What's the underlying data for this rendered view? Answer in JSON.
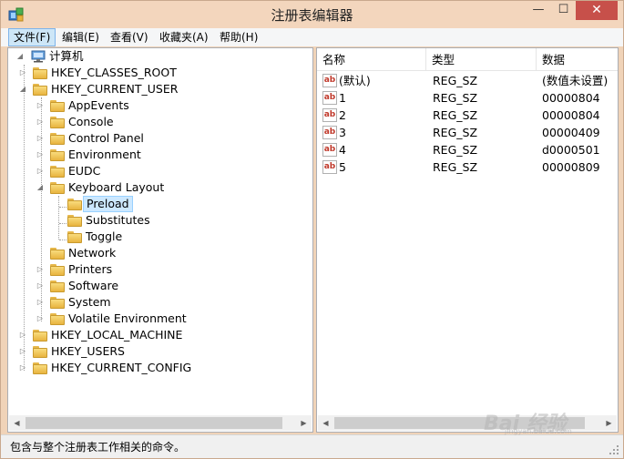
{
  "window": {
    "title": "注册表编辑器"
  },
  "titlebar": {
    "minimize": "—",
    "maximize": "☐",
    "close": "✕"
  },
  "menu": [
    {
      "label": "文件(F)"
    },
    {
      "label": "编辑(E)"
    },
    {
      "label": "查看(V)"
    },
    {
      "label": "收藏夹(A)"
    },
    {
      "label": "帮助(H)"
    }
  ],
  "tree": {
    "root": "计算机",
    "nodes": [
      {
        "label": "HKEY_CLASSES_ROOT",
        "expander": "▷"
      },
      {
        "label": "HKEY_CURRENT_USER",
        "expander": "◢"
      },
      {
        "label": "AppEvents",
        "expander": "▷"
      },
      {
        "label": "Console",
        "expander": "▷"
      },
      {
        "label": "Control Panel",
        "expander": "▷"
      },
      {
        "label": "Environment",
        "expander": "▷"
      },
      {
        "label": "EUDC",
        "expander": "▷"
      },
      {
        "label": "Keyboard Layout",
        "expander": "◢"
      },
      {
        "label": "Preload",
        "expander": "",
        "selected": true
      },
      {
        "label": "Substitutes",
        "expander": ""
      },
      {
        "label": "Toggle",
        "expander": ""
      },
      {
        "label": "Network",
        "expander": ""
      },
      {
        "label": "Printers",
        "expander": "▷"
      },
      {
        "label": "Software",
        "expander": "▷"
      },
      {
        "label": "System",
        "expander": "▷"
      },
      {
        "label": "Volatile Environment",
        "expander": "▷"
      },
      {
        "label": "HKEY_LOCAL_MACHINE",
        "expander": "▷"
      },
      {
        "label": "HKEY_USERS",
        "expander": "▷"
      },
      {
        "label": "HKEY_CURRENT_CONFIG",
        "expander": "▷"
      }
    ]
  },
  "list": {
    "columns": [
      "名称",
      "类型",
      "数据"
    ],
    "rows": [
      {
        "name": "(默认)",
        "type": "REG_SZ",
        "data": "(数值未设置)"
      },
      {
        "name": "1",
        "type": "REG_SZ",
        "data": "00000804"
      },
      {
        "name": "2",
        "type": "REG_SZ",
        "data": "00000804"
      },
      {
        "name": "3",
        "type": "REG_SZ",
        "data": "00000409"
      },
      {
        "name": "4",
        "type": "REG_SZ",
        "data": "d0000501"
      },
      {
        "name": "5",
        "type": "REG_SZ",
        "data": "00000809"
      }
    ],
    "value_icon": "ab"
  },
  "status": {
    "text": "包含与整个注册表工作相关的命令。"
  },
  "watermark": {
    "text": "Bai 经验",
    "sub": "jingyan.baidu.com"
  },
  "icons": {
    "app": "regedit-icon",
    "computer": "computer-icon",
    "folder": "folder-icon",
    "value": "string-value-icon"
  },
  "colors": {
    "frame": "#f3d6bd",
    "close": "#c7504a",
    "selection": "#cce8ff",
    "menu_active": "#cde6f7"
  }
}
